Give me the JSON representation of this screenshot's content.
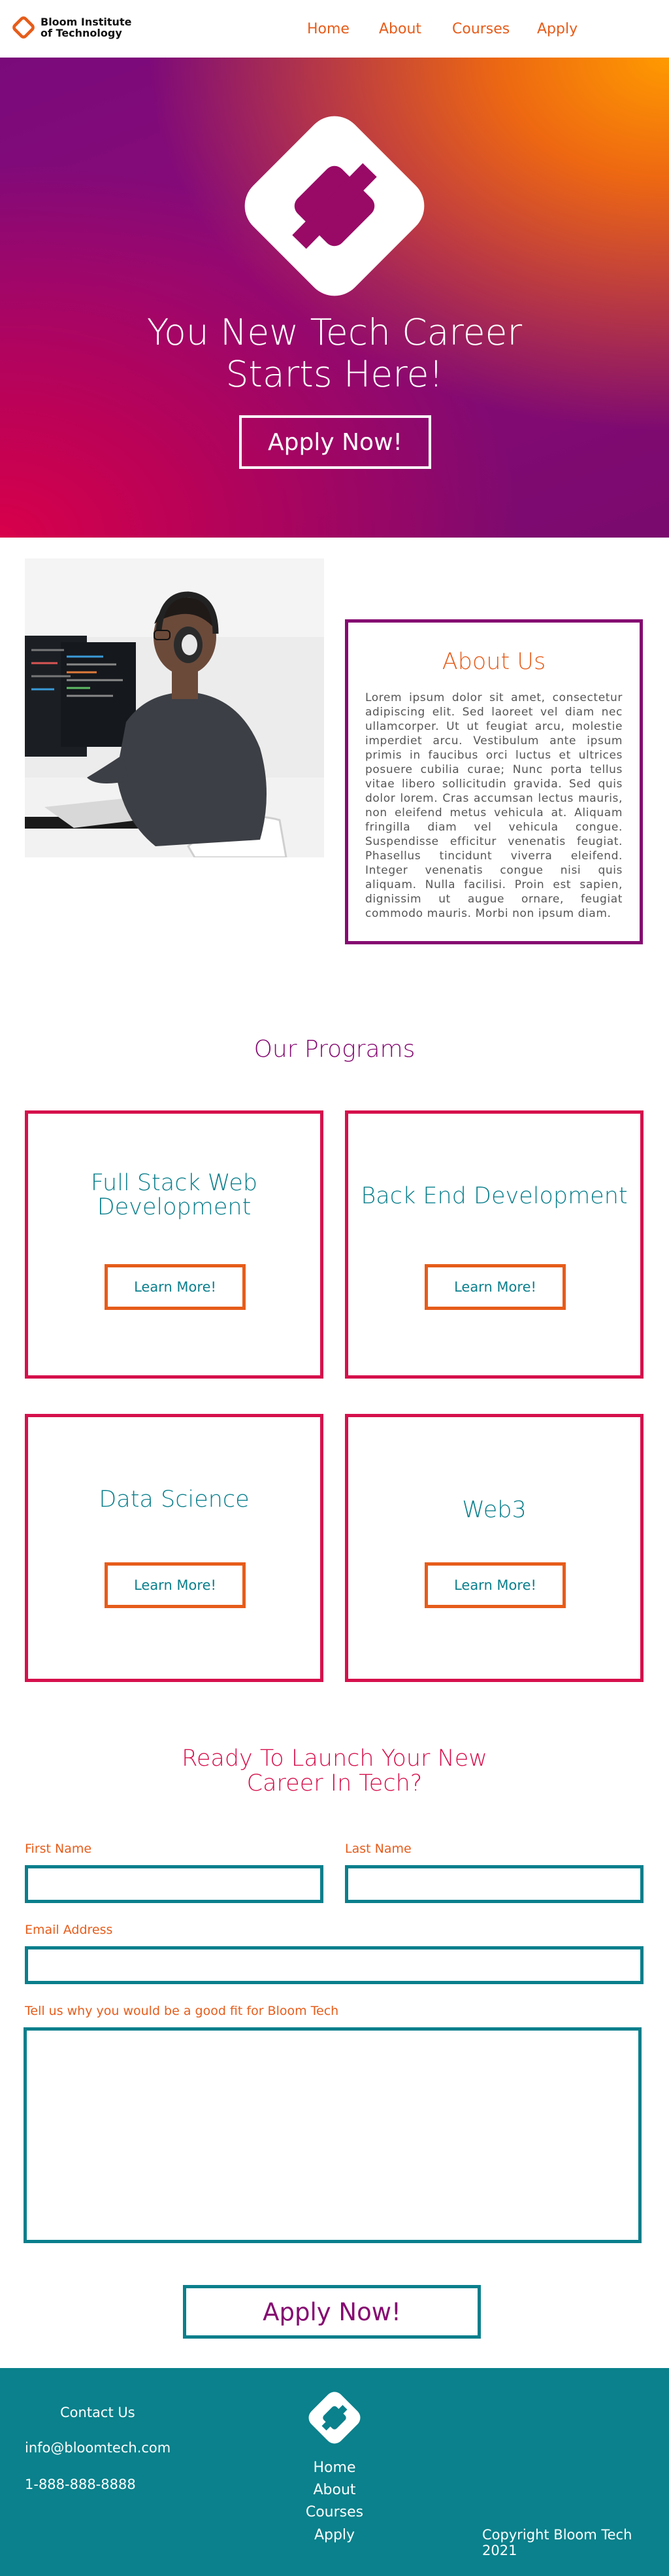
{
  "header": {
    "logo_line1": "Bloom Institute",
    "logo_line2": "of Technology",
    "nav": [
      "Home",
      "About",
      "Courses",
      "Apply"
    ]
  },
  "hero": {
    "title_line1": "You New Tech Career",
    "title_line2": "Starts Here!",
    "button": "Apply Now!"
  },
  "about": {
    "title": "About Us",
    "text": "Lorem ipsum dolor sit amet, consectetur adipiscing elit. Sed laoreet vel diam nec ullamcorper. Ut ut feugiat arcu, molestie imperdiet arcu. Vestibulum ante ipsum primis in faucibus orci luctus et ultrices posuere cubilia curae; Nunc porta tellus vitae libero sollicitudin gravida. Sed quis dolor lorem. Cras accumsan lectus mauris, non eleifend metus vehicula at. Aliquam fringilla diam vel vehicula congue. Suspendisse efficitur venenatis feugiat. Phasellus tincidunt viverra eleifend. Integer venenatis congue nisi quis aliquam. Nulla facilisi. Proin est sapien, dignissim ut augue ornare, feugiat commodo mauris. Morbi non ipsum diam."
  },
  "programs": {
    "title": "Our Programs",
    "cards": [
      {
        "title": "Full Stack Web Development",
        "button": "Learn More!"
      },
      {
        "title": "Back End Development",
        "button": "Learn More!"
      },
      {
        "title": "Data Science",
        "button": "Learn More!"
      },
      {
        "title": "Web3",
        "button": "Learn More!"
      }
    ]
  },
  "form": {
    "title_line1": "Ready To Launch Your New",
    "title_line2": "Career In Tech?",
    "first_name_label": "First Name",
    "last_name_label": "Last Name",
    "email_label": "Email Address",
    "reason_label": "Tell us why you would be a good fit for Bloom Tech",
    "submit": "Apply Now!"
  },
  "footer": {
    "contact_title": "Contact Us",
    "email": "info@bloomtech.com",
    "phone": "1-888-888-8888",
    "nav": [
      "Home",
      "About",
      "Courses",
      "Apply"
    ],
    "copyright": "Copyright Bloom Tech 2021"
  },
  "colors": {
    "accent_orange": "#e65c1a",
    "purple": "#850a71",
    "crimson": "#d6104c",
    "teal": "#0a7f8c"
  }
}
